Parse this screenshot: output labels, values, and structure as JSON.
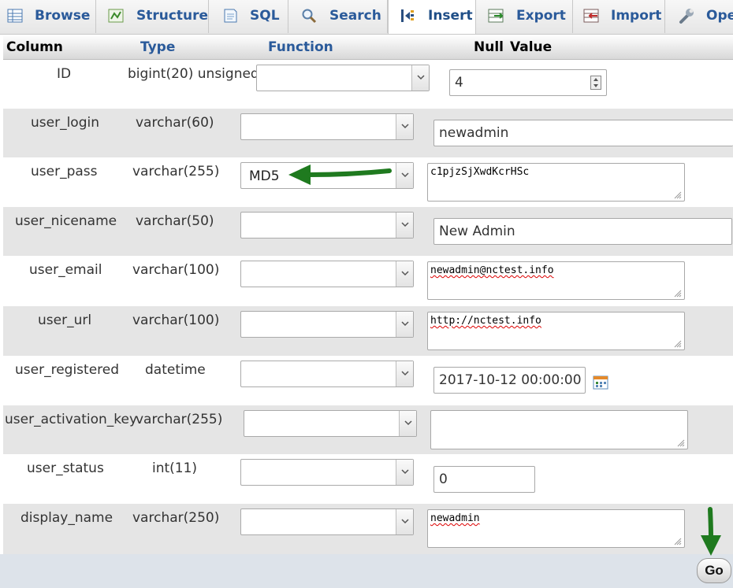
{
  "tabs": [
    {
      "label": "Browse",
      "icon": "browse-icon"
    },
    {
      "label": "Structure",
      "icon": "structure-icon"
    },
    {
      "label": "SQL",
      "icon": "sql-icon"
    },
    {
      "label": "Search",
      "icon": "search-icon"
    },
    {
      "label": "Insert",
      "icon": "insert-icon",
      "active": true
    },
    {
      "label": "Export",
      "icon": "export-icon"
    },
    {
      "label": "Import",
      "icon": "import-icon"
    },
    {
      "label": "Ope",
      "icon": "operations-icon"
    }
  ],
  "header": {
    "column": "Column",
    "type": "Type",
    "function": "Function",
    "null": "Null",
    "value": "Value"
  },
  "rows": [
    {
      "column": "ID",
      "type": "bigint(20) unsigned",
      "function": "",
      "value": "4"
    },
    {
      "column": "user_login",
      "type": "varchar(60)",
      "function": "",
      "value": "newadmin"
    },
    {
      "column": "user_pass",
      "type": "varchar(255)",
      "function": "MD5",
      "value": "c1pjzSjXwdKcrHSc"
    },
    {
      "column": "user_nicename",
      "type": "varchar(50)",
      "function": "",
      "value": "New Admin"
    },
    {
      "column": "user_email",
      "type": "varchar(100)",
      "function": "",
      "value": "newadmin@nctest.info"
    },
    {
      "column": "user_url",
      "type": "varchar(100)",
      "function": "",
      "value": "http://nctest.info"
    },
    {
      "column": "user_registered",
      "type": "datetime",
      "function": "",
      "value": "2017-10-12 00:00:00"
    },
    {
      "column": "user_activation_key",
      "type": "varchar(255)",
      "function": "",
      "value": ""
    },
    {
      "column": "user_status",
      "type": "int(11)",
      "function": "",
      "value": "0"
    },
    {
      "column": "display_name",
      "type": "varchar(250)",
      "function": "",
      "value": "newadmin"
    }
  ],
  "footer": {
    "go_label": "Go"
  },
  "colors": {
    "tab_text": "#2a5a9a",
    "row_alt": "#e5e5e5",
    "annotation_arrow": "#1f7a1f",
    "footer_bg": "#dde3ea"
  }
}
